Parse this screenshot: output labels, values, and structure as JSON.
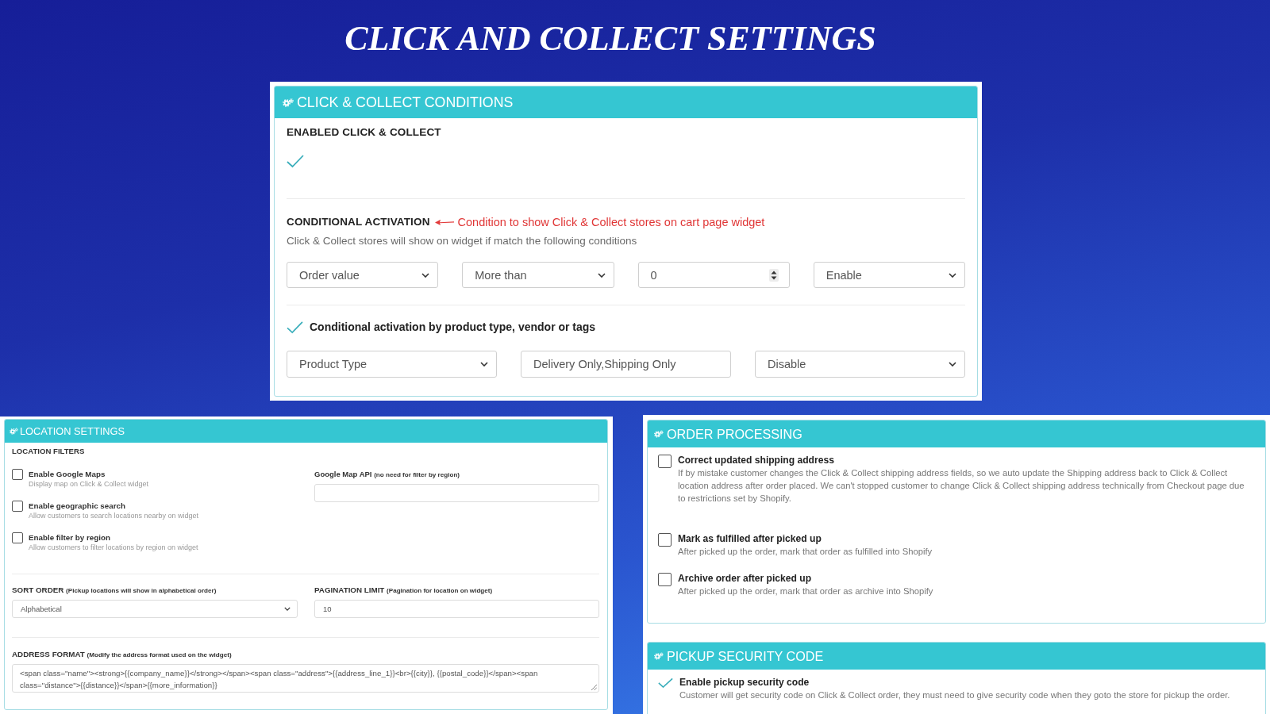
{
  "page_title": "CLICK AND COLLECT SETTINGS",
  "conditions_panel": {
    "title": "CLICK & COLLECT CONDITIONS",
    "enabled_setting": {
      "label": "ENABLED CLICK & COLLECT",
      "checked": true
    },
    "conditional_activation": {
      "label": "CONDITIONAL ACTIVATION",
      "annotation": "Condition to show Click & Collect stores on cart page widget",
      "description": "Click & Collect stores will show on widget if match the following conditions",
      "fields": [
        {
          "kind": "select",
          "value": "Order value"
        },
        {
          "kind": "select",
          "value": "More than"
        },
        {
          "kind": "number",
          "value": "0"
        },
        {
          "kind": "select",
          "value": "Enable"
        }
      ]
    },
    "product_activation": {
      "label": "Conditional activation by product type, vendor or tags",
      "checked": true,
      "fields": [
        {
          "kind": "select",
          "value": "Product Type"
        },
        {
          "kind": "text",
          "value": "Delivery Only,Shipping Only"
        },
        {
          "kind": "select",
          "value": "Disable"
        }
      ]
    }
  },
  "location_panel": {
    "title": "LOCATION SETTINGS",
    "filters_heading": "LOCATION FILTERS",
    "filters": [
      {
        "label": "Enable Google Maps",
        "description": "Display map on Click & Collect widget",
        "checked": false
      },
      {
        "label": "Enable geographic search",
        "description": "Allow customers to search locations nearby on widget",
        "checked": false
      },
      {
        "label": "Enable filter by region",
        "description": "Allow customers to filter locations by region on widget",
        "checked": false
      }
    ],
    "google_map_api": {
      "label": "Google Map API",
      "hint": "(no need for filter by region)",
      "field": {
        "kind": "text"
      }
    },
    "sort_order": {
      "label": "SORT ORDER",
      "hint": "(Pickup locations will show in alphabetical order)",
      "field": {
        "kind": "select",
        "value": "Alphabetical"
      }
    },
    "pagination_limit": {
      "label": "PAGINATION LIMIT",
      "hint": "(Pagination for location on widget)",
      "field": {
        "kind": "text",
        "value": "10"
      }
    },
    "address_format": {
      "label": "ADDRESS FORMAT",
      "hint": "(Modify the address format used on the widget)",
      "field": {
        "kind": "textarea",
        "value": "<span class=\"name\"><strong>{{company_name}}</strong></span><span class=\"address\">{{address_line_1}}<br>{{city}}, {{postal_code}}</span><span class=\"distance\">{{distance}}</span>{{more_information}}"
      }
    }
  },
  "order_panel": {
    "title": "ORDER PROCESSING",
    "options": [
      {
        "label": "Correct updated shipping address",
        "description": "If by mistake customer changes the Click & Collect shipping address fields, so we auto update the Shipping address back to Click & Collect location address after order placed. We can't stopped customer to change Click & Collect shipping address technically from Checkout page due to restrictions set by Shopify.",
        "checked": false
      },
      {
        "label": "Mark as fulfilled after picked up",
        "description": "After picked up the order, mark that order as fulfilled into Shopify",
        "checked": false
      },
      {
        "label": "Archive order after picked up",
        "description": "After picked up the order, mark that order as archive into Shopify",
        "checked": false
      }
    ]
  },
  "security_panel": {
    "title": "PICKUP SECURITY CODE",
    "options": [
      {
        "label": "Enable pickup security code",
        "description": "Customer will get security code on Click & Collect order, they must need to give security code when they goto the store for pickup the order.",
        "checked": true
      }
    ]
  }
}
